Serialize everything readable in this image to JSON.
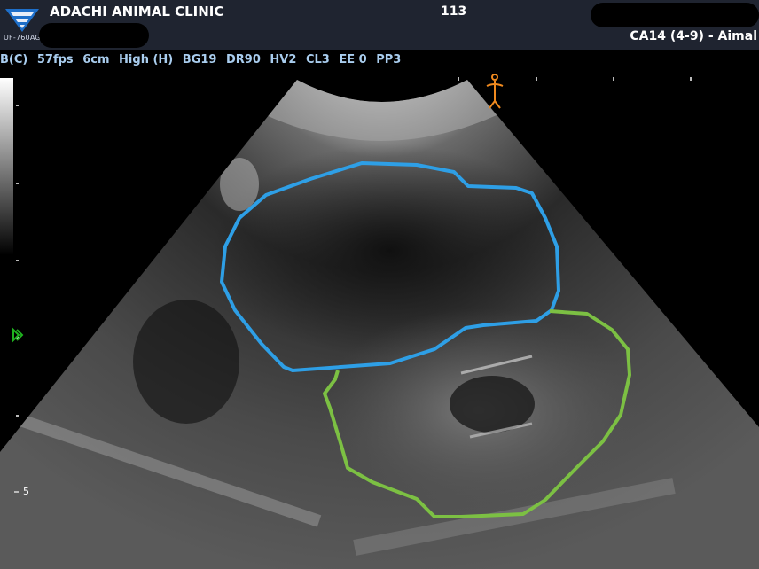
{
  "header": {
    "clinic_name": "ADACHI ANIMAL CLINIC",
    "image_number": "113",
    "probe_info": "CA14 (4-9) - Aimal",
    "logo_model": "UF-760AG"
  },
  "params": {
    "mode": "B(C)",
    "frame_rate": "57fps",
    "depth": "6cm",
    "frequency": "High (H)",
    "gain": "BG19",
    "dynamic_range": "DR90",
    "hv": "HV2",
    "cl": "CL3",
    "ee": "EE 0",
    "pp": "PP3"
  },
  "scale": {
    "depth_mark_label": "5"
  },
  "colors": {
    "header_bg": "#1f2430",
    "params_text": "#a9cdee",
    "outline_blue": "#2e9fe6",
    "outline_green": "#7cc043",
    "focus_marker": "#1fb31f",
    "orientation_marker": "#f08a1f"
  },
  "icons": {
    "logo": "fukuda-logo-icon",
    "orientation": "body-orientation-icon",
    "focus": "focus-marker-icon"
  }
}
